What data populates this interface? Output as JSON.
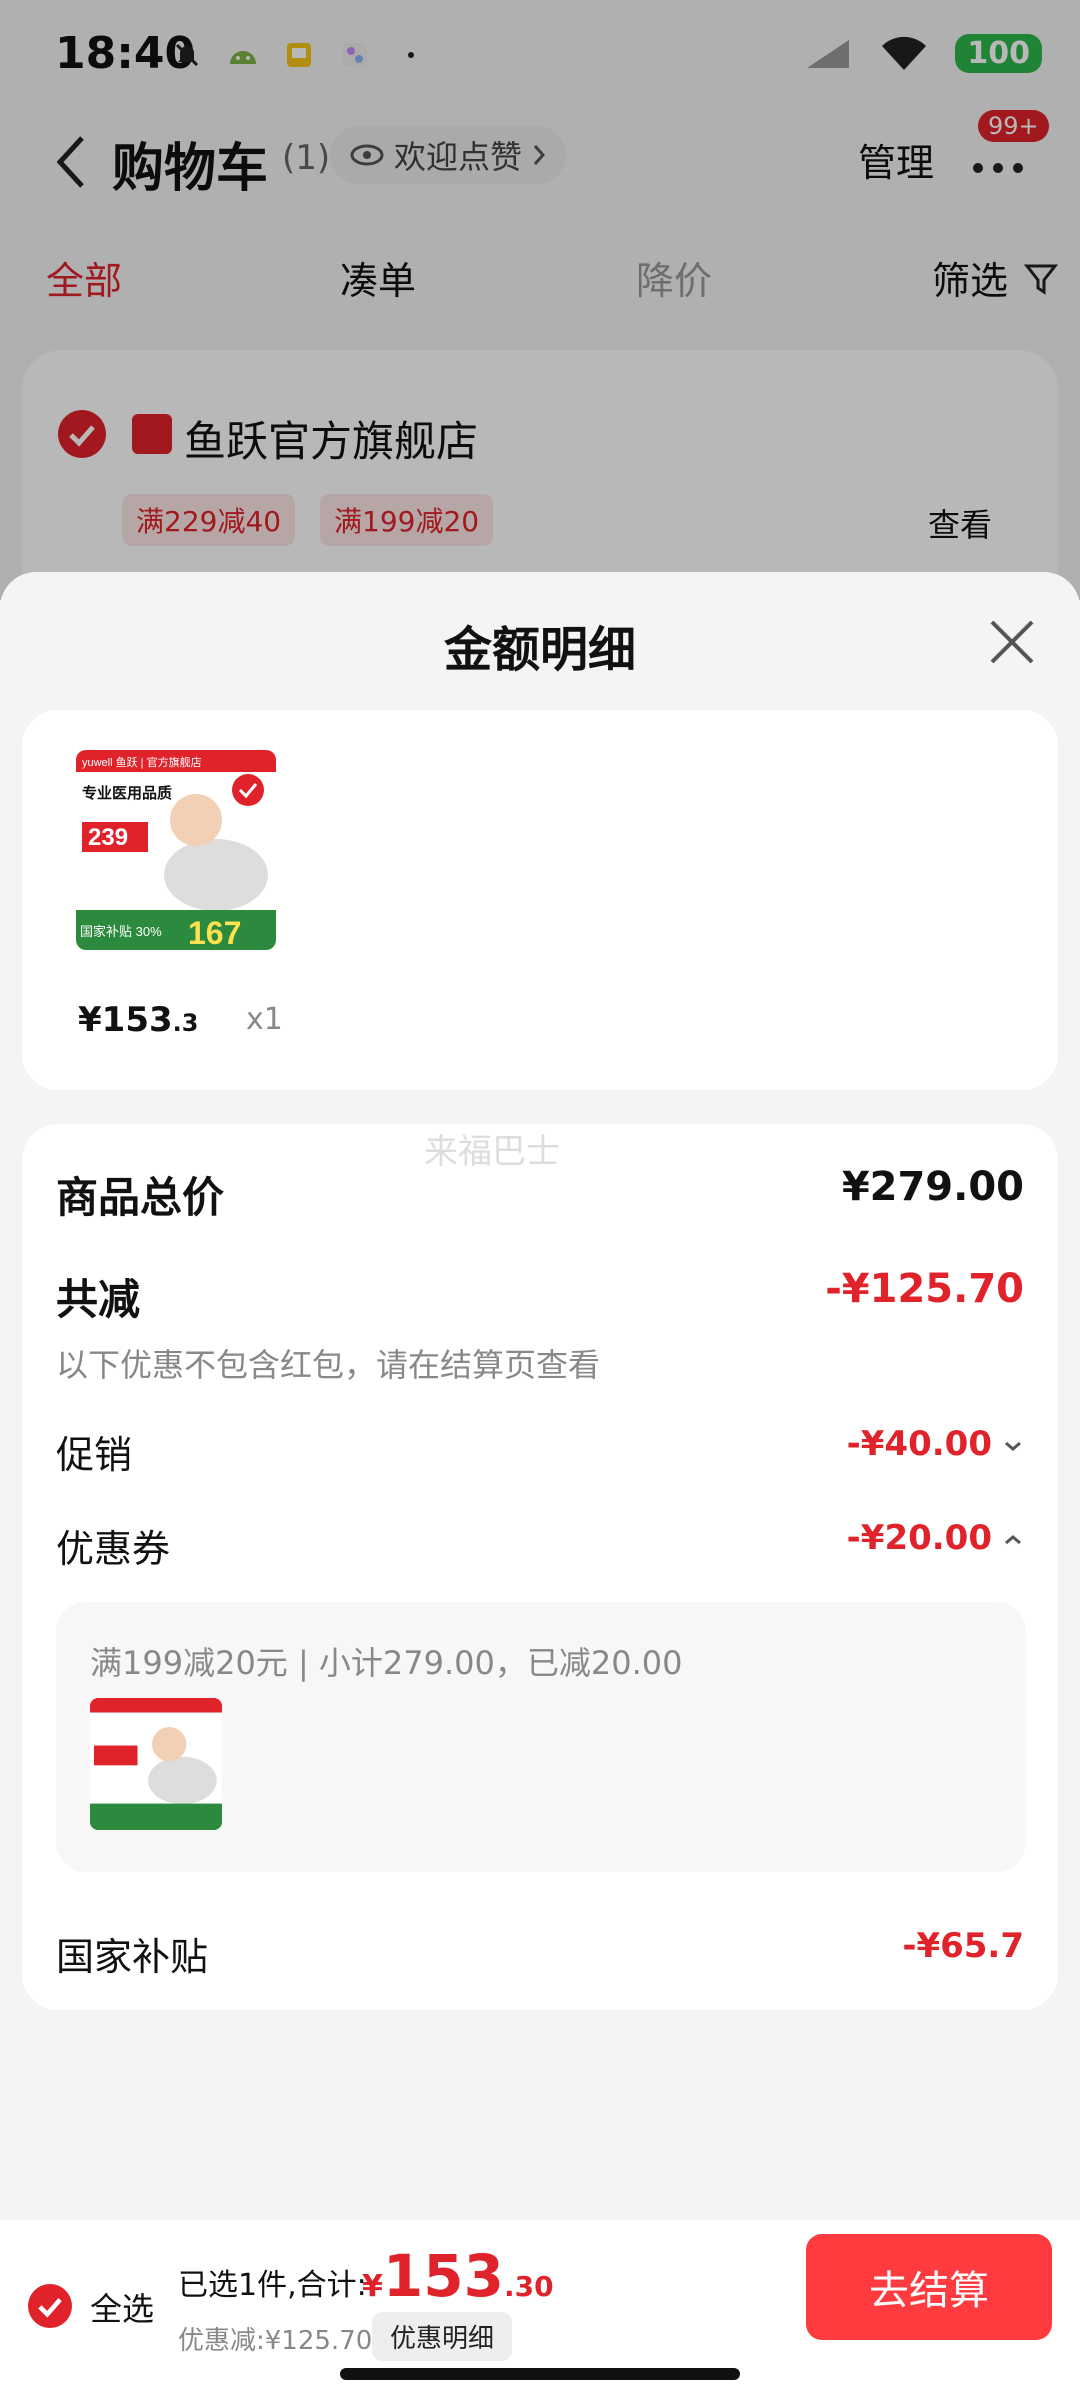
{
  "status": {
    "time": "18:40",
    "battery": "100"
  },
  "nav": {
    "title": "购物车",
    "count": "(1)",
    "like": "欢迎点赞",
    "manage": "管理",
    "badge": "99+"
  },
  "tabs": [
    {
      "label": "全部"
    },
    {
      "label": "凑单"
    },
    {
      "label": "降价"
    },
    {
      "label": "筛选"
    }
  ],
  "store": {
    "name": "鱼跃官方旗舰店",
    "coupons": [
      "满229减40",
      "满199减20"
    ],
    "view": "查看"
  },
  "sheet": {
    "title": "金额明细",
    "product": {
      "price": "¥153",
      "price_dec": ".3",
      "qty": "x1",
      "image_text": {
        "brand": "yuwell 鱼跃 | 官方旗舰店",
        "headline": "专业医用品质",
        "price": "239",
        "subsidy": "国家补贴 30%",
        "subsidy_price": "167"
      }
    },
    "watermark": "来福巴士",
    "total_label": "商品总价",
    "total_value": "¥279.00",
    "reduce_label": "共减",
    "reduce_value": "-¥125.70",
    "hint": "以下优惠不包含红包，请在结算页查看",
    "promo_label": "促销",
    "promo_value": "-¥40.00",
    "coupon_label": "优惠券",
    "coupon_value": "-¥20.00",
    "coupon_detail": "满199减20元 | 小计279.00，已减20.00",
    "subsidy_label": "国家补贴",
    "subsidy_value": "-¥65.7"
  },
  "bottom": {
    "select_all": "全选",
    "selected": "已选1件,合计:",
    "yen": "¥",
    "price_int": "153",
    "price_dec": ".30",
    "discount": "优惠减:¥125.70",
    "detail_btn": "优惠明细",
    "checkout": "去结算"
  },
  "colors": {
    "accent": "#e0232b",
    "checkout": "#ff3b3f"
  }
}
